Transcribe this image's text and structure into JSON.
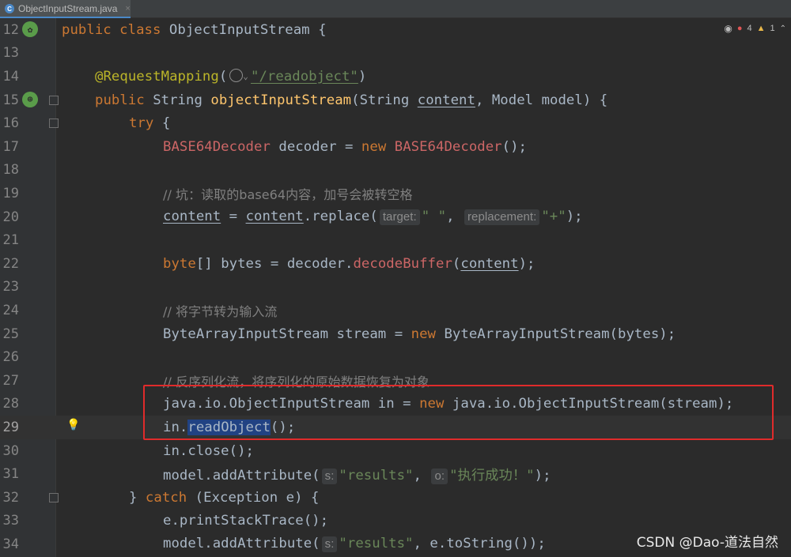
{
  "tab": {
    "filename": "ObjectInputStream.java",
    "close": "×"
  },
  "inspection": {
    "errors": "4",
    "warnings": "1"
  },
  "lines": [
    {
      "n": "12"
    },
    {
      "n": "13"
    },
    {
      "n": "14"
    },
    {
      "n": "15"
    },
    {
      "n": "16"
    },
    {
      "n": "17"
    },
    {
      "n": "18"
    },
    {
      "n": "19"
    },
    {
      "n": "20"
    },
    {
      "n": "21"
    },
    {
      "n": "22"
    },
    {
      "n": "23"
    },
    {
      "n": "24"
    },
    {
      "n": "25"
    },
    {
      "n": "26"
    },
    {
      "n": "27"
    },
    {
      "n": "28"
    },
    {
      "n": "29"
    },
    {
      "n": "30"
    },
    {
      "n": "31"
    },
    {
      "n": "32"
    },
    {
      "n": "33"
    },
    {
      "n": "34"
    }
  ],
  "code": {
    "l12": {
      "a": "public class ",
      "b": "ObjectInputStream {"
    },
    "l14": {
      "ann": "@RequestMapping",
      "open": "(",
      "path": "\"/readobject\"",
      "close": ")"
    },
    "l15": {
      "kw": "public ",
      "t": "String ",
      "fn": "objectInputStream",
      "p1": "(String ",
      "content": "content",
      "p2": ", Model model) {"
    },
    "l16": {
      "kw": "try",
      "t": " {"
    },
    "l17": {
      "cls": "BASE64Decoder",
      "t": " decoder = ",
      "kw": "new ",
      "cls2": "BASE64Decoder",
      "end": "();"
    },
    "l19": {
      "cmt": "// 坑：读取的base64内容，加号会被转空格"
    },
    "l20": {
      "v1": "content",
      "eq": " = ",
      "v2": "content",
      "call": ".replace(",
      "hint1": "target:",
      "s1": "\" \"",
      "sep": ", ",
      "hint2": "replacement:",
      "s2": "\"+\"",
      "end": ");"
    },
    "l22": {
      "kw": "byte",
      "t": "[] bytes = decoder.",
      "m": "decodeBuffer",
      "open": "(",
      "arg": "content",
      "end": ");"
    },
    "l24": {
      "cmt": "// 将字节转为输入流"
    },
    "l25": {
      "t": "ByteArrayInputStream stream = ",
      "kw": "new ",
      "t2": "ByteArrayInputStream(bytes);"
    },
    "l27": {
      "cmt": "// 反序列化流，将序列化的原始数据恢复为对象"
    },
    "l28": {
      "t": "java.io.ObjectInputStream in = ",
      "kw": "new ",
      "t2": "java.io.ObjectInputStream(stream);"
    },
    "l29": {
      "t": "in.",
      "sel": "readObject",
      "end": "();"
    },
    "l30": {
      "t": "in.close();"
    },
    "l31": {
      "t": "model.addAttribute(",
      "hint1": "s:",
      "s1": "\"results\"",
      "sep": ", ",
      "hint2": "o:",
      "s2": "\"执行成功！\"",
      "end": ");"
    },
    "l32": {
      "t": "} ",
      "kw": "catch",
      "t2": " (Exception e) {"
    },
    "l33": {
      "t": "e.printStackTrace();"
    },
    "l34": {
      "t": "model.addAttribute(",
      "hint1": "s:",
      "s1": "\"results\"",
      "end": ", e.toString());"
    }
  },
  "watermark": "CSDN @Dao-道法自然"
}
